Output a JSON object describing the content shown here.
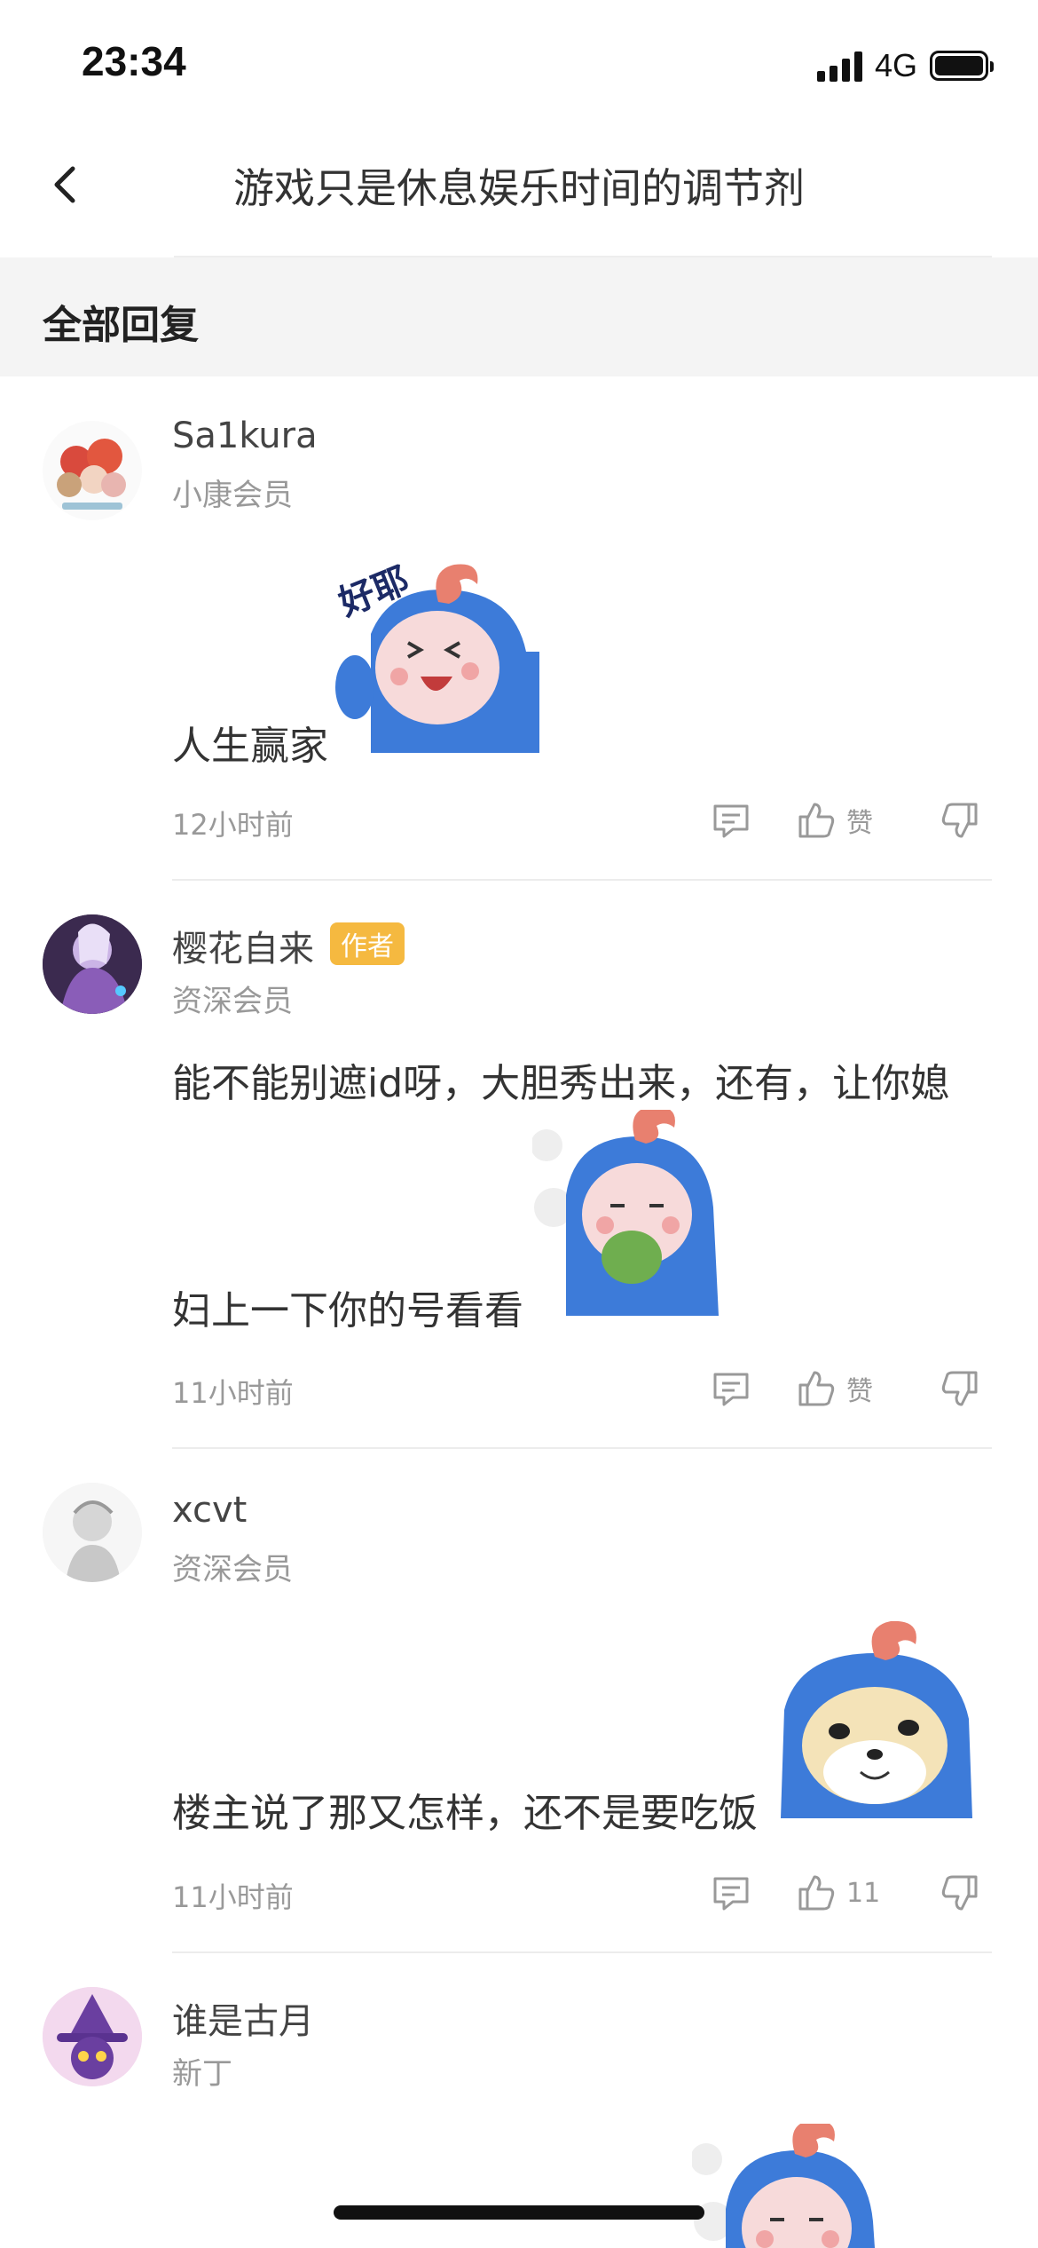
{
  "status_bar": {
    "time": "23:34",
    "network": "4G"
  },
  "nav": {
    "title": "游戏只是休息娱乐时间的调节剂"
  },
  "section": {
    "title": "全部回复"
  },
  "comments": [
    {
      "username": "Sa1kura",
      "level": "小康会员",
      "text": "人生赢家",
      "sticker_caption": "好耶",
      "time": "12小时前",
      "like_label": "赞"
    },
    {
      "username": "樱花自来",
      "badge": "作者",
      "level": "资深会员",
      "text_line1": "能不能别遮id呀，大胆秀出来，还有，让你媳",
      "text_line2": "妇上一下你的号看看",
      "time": "11小时前",
      "like_label": "赞"
    },
    {
      "username": "xcvt",
      "level": "资深会员",
      "text": "楼主说了那又怎样，还不是要吃饭",
      "time": "11小时前",
      "like_label": "11"
    },
    {
      "username": "谁是古月",
      "level": "新丁"
    }
  ],
  "colors": {
    "accent_badge": "#f5b940",
    "sticker_blue": "#3d7bd9",
    "sticker_crest": "#e8806f"
  },
  "icons": [
    "back-chevron-icon",
    "signal-icon",
    "battery-icon",
    "comment-icon",
    "thumbs-up-icon",
    "thumbs-down-icon"
  ]
}
